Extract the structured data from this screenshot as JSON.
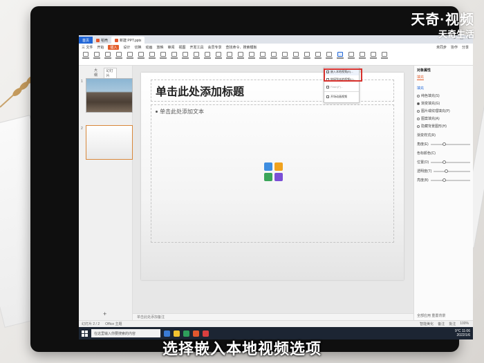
{
  "watermark": {
    "line1": "天奇·视频",
    "line2": "天奇生活"
  },
  "subtitle": "选择嵌入本地视频选项",
  "titlebar": {
    "home_tab": "首页",
    "app_tab": "稻壳",
    "doc_tab": "新建 PPT.pptx"
  },
  "menubar": {
    "items": [
      "三 文件",
      "开始",
      "插入",
      "设计",
      "切换",
      "动画",
      "放映",
      "审阅",
      "视图",
      "开发工具",
      "会员专享"
    ],
    "active_index": 2,
    "search": "查找命令、搜索模板",
    "right": [
      "未同步",
      "协作",
      "分享"
    ]
  },
  "dropdown": {
    "items": [
      "嵌入本地视频(E)...",
      "链接到本地视频(L)...",
      "Flash(F)...",
      "开场动画视频"
    ],
    "selected_index": 0
  },
  "thumbs": {
    "tabs": [
      "大纲",
      "幻灯片"
    ],
    "numbers": [
      "1",
      "2"
    ]
  },
  "slide": {
    "title": "单击此处添加标题",
    "body": "单击此处添加文本"
  },
  "notes": "单击此处添加备注",
  "panel": {
    "title": "对象属性",
    "tab": "填充",
    "section": "填充",
    "options": [
      "纯色填充(S)",
      "渐变填充(G)",
      "图片或纹理填充(P)",
      "图案填充(A)",
      "隐藏背景图形(H)"
    ],
    "checked_option": 1,
    "rows": [
      "渐变样式(R)",
      "角度(E)",
      "色标颜色(C)",
      "位置(O)",
      "透明度(T)",
      "亮度(B)"
    ],
    "footer": [
      "全部应用",
      "重置背景"
    ]
  },
  "statusbar": {
    "left": [
      "幻灯片 2 / 2",
      "Office 主题"
    ],
    "right": [
      "智能美化",
      "备注",
      "批注",
      "100%"
    ]
  },
  "taskbar": {
    "search": "在这里输入你要搜索的内容",
    "time": "11:06",
    "date": "2022/1/6",
    "temp": "9°C"
  }
}
